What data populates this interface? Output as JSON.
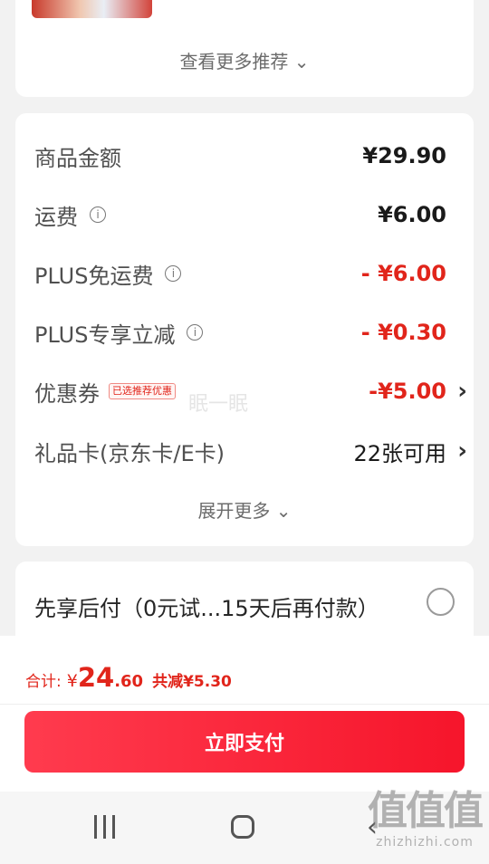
{
  "recommendations": {
    "more_label": "查看更多推荐"
  },
  "summary": {
    "rows": [
      {
        "label": "商品金额",
        "value": "¥29.90"
      },
      {
        "label": "运费",
        "value": "¥6.00"
      },
      {
        "label": "PLUS免运费",
        "value": "- ¥6.00"
      },
      {
        "label": "PLUS专享立减",
        "value": "- ¥0.30"
      },
      {
        "label": "优惠券",
        "badge": "已选推荐优惠",
        "value": "-¥5.00"
      },
      {
        "label": "礼品卡(京东卡/E卡)",
        "value": "22张可用"
      }
    ],
    "expand_label": "展开更多",
    "watermark": "眠一眠"
  },
  "pay_later": {
    "label": "先享后付（0元试...15天后再付款）"
  },
  "footer": {
    "total_label": "合计:",
    "currency": "¥",
    "total_int": "24",
    "total_dec": ".60",
    "savings": "共减¥5.30",
    "pay_button": "立即支付"
  },
  "site_watermark": {
    "logo_text": "值值值",
    "domain": "zhizhizhi.com"
  },
  "colors": {
    "accent": "#e1251b",
    "button": "#f6152b",
    "background": "#f2f2f2"
  },
  "icons": [
    "info-icon",
    "chevron-down-icon",
    "chevron-right-icon",
    "radio-icon",
    "recent-apps-icon",
    "home-icon",
    "back-icon"
  ]
}
